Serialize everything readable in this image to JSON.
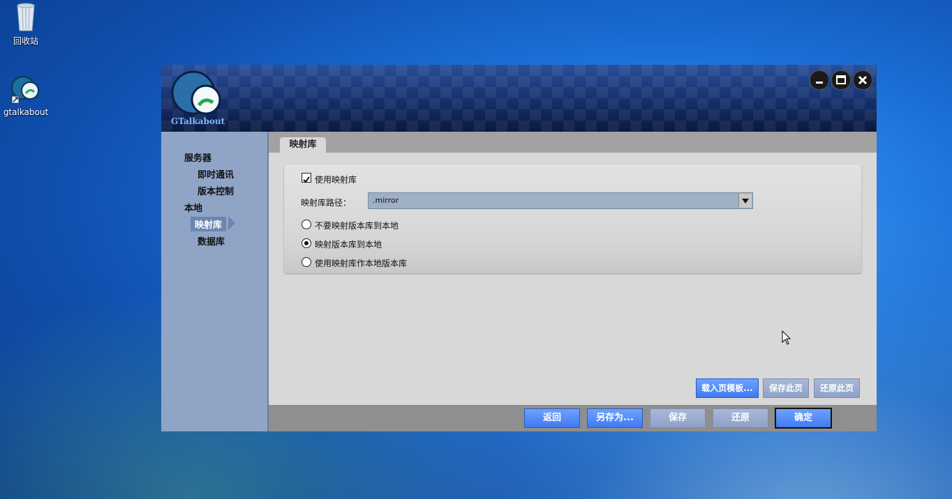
{
  "desktop": {
    "icons": [
      {
        "label": "回收站"
      },
      {
        "label": "gtalkabout"
      }
    ]
  },
  "window": {
    "logo_text": "GTalkabout",
    "controls": [
      "minimize-icon",
      "maximize-icon",
      "close-icon"
    ]
  },
  "sidebar": {
    "items": [
      {
        "label": "服务器"
      },
      {
        "label": "即时通讯"
      },
      {
        "label": "版本控制"
      },
      {
        "label": "本地"
      },
      {
        "label": "映射库"
      },
      {
        "label": "数据库"
      }
    ],
    "selected": "映射库"
  },
  "main": {
    "tab_label": "映射库",
    "use_mirror_label": "使用映射库",
    "use_mirror_checked": true,
    "path_label": "映射库路径：",
    "path_value": ".mirror",
    "radio_options": [
      {
        "label": "不要映射版本库到本地",
        "selected": false
      },
      {
        "label": "映射版本库到本地",
        "selected": true
      },
      {
        "label": "使用映射库作本地版本库",
        "selected": false
      }
    ],
    "page_buttons": {
      "load_template": "载入页模板...",
      "save_page": "保存此页",
      "restore_page": "还原此页"
    }
  },
  "footer": {
    "back": "返回",
    "save_as": "另存为...",
    "save": "保存",
    "restore": "还原",
    "ok": "确定"
  },
  "colors": {
    "accent_blue": "#3f7af0",
    "sidebar_bg": "#90a4c6",
    "titlebar_bg": "#132c66"
  }
}
